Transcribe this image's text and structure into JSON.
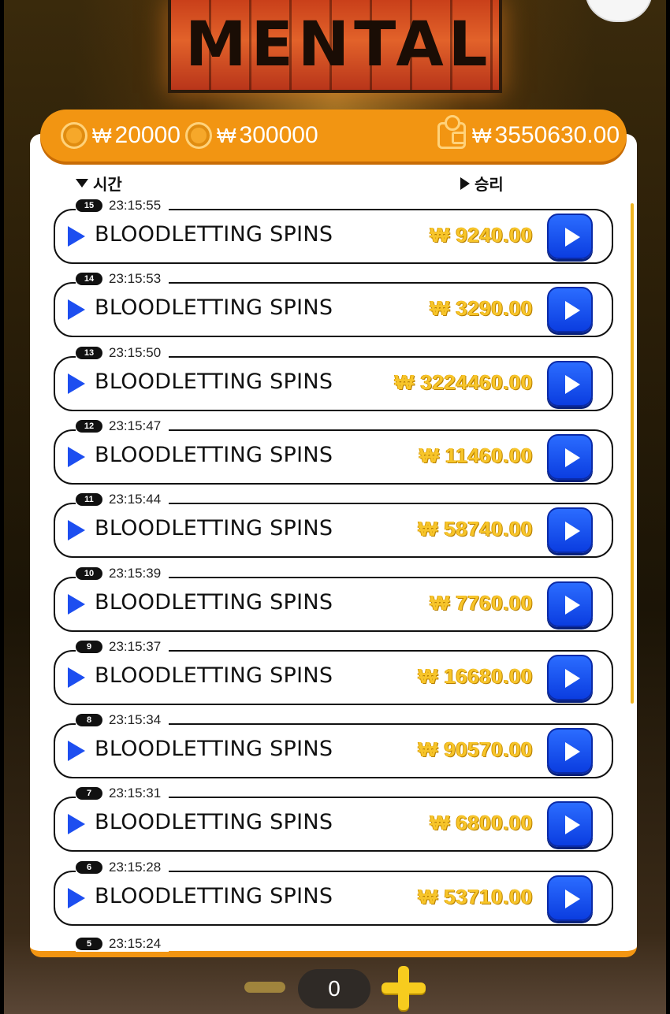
{
  "logo": {
    "text": "MENTAL"
  },
  "balances": {
    "currency_symbol": "₩",
    "coin1_value": "20000",
    "coin2_value": "300000",
    "wallet_value": "3550630.00"
  },
  "columns": {
    "time_label": "시간",
    "win_label": "승리"
  },
  "history": [
    {
      "badge": "15",
      "time": "23:15:55",
      "title": "BLOODLETTING SPINS",
      "amount": "₩ 9240.00"
    },
    {
      "badge": "14",
      "time": "23:15:53",
      "title": "BLOODLETTING SPINS",
      "amount": "₩ 3290.00"
    },
    {
      "badge": "13",
      "time": "23:15:50",
      "title": "BLOODLETTING SPINS",
      "amount": "₩ 3224460.00"
    },
    {
      "badge": "12",
      "time": "23:15:47",
      "title": "BLOODLETTING SPINS",
      "amount": "₩ 11460.00"
    },
    {
      "badge": "11",
      "time": "23:15:44",
      "title": "BLOODLETTING SPINS",
      "amount": "₩ 58740.00"
    },
    {
      "badge": "10",
      "time": "23:15:39",
      "title": "BLOODLETTING SPINS",
      "amount": "₩ 7760.00"
    },
    {
      "badge": "9",
      "time": "23:15:37",
      "title": "BLOODLETTING SPINS",
      "amount": "₩ 16680.00"
    },
    {
      "badge": "8",
      "time": "23:15:34",
      "title": "BLOODLETTING SPINS",
      "amount": "₩ 90570.00"
    },
    {
      "badge": "7",
      "time": "23:15:31",
      "title": "BLOODLETTING SPINS",
      "amount": "₩ 6800.00"
    },
    {
      "badge": "6",
      "time": "23:15:28",
      "title": "BLOODLETTING SPINS",
      "amount": "₩ 53710.00"
    }
  ],
  "partial_row": {
    "badge": "5",
    "time": "23:15:24"
  },
  "bet_counter": {
    "value": "0"
  },
  "colors": {
    "accent": "#f29512",
    "button_blue": "#1d4ef0",
    "amount_gold": "#f7c52a"
  }
}
